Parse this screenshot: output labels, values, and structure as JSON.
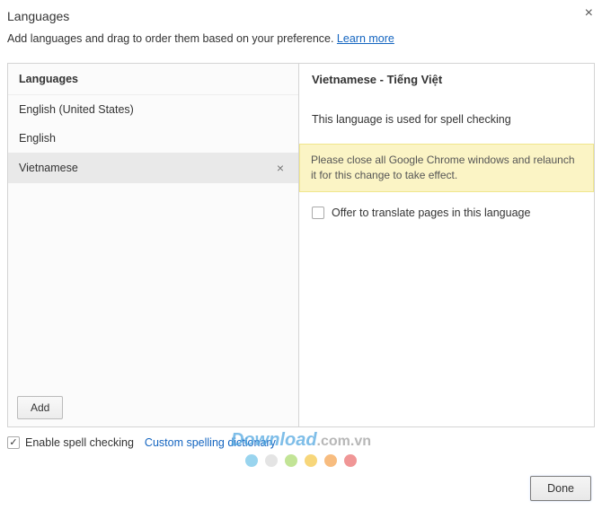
{
  "header": {
    "title": "Languages",
    "subtitle_text": "Add languages and drag to order them based on your preference. ",
    "learn_more": "Learn more"
  },
  "left": {
    "heading": "Languages",
    "items": [
      {
        "label": "English (United States)",
        "selected": false
      },
      {
        "label": "English",
        "selected": false
      },
      {
        "label": "Vietnamese",
        "selected": true
      }
    ],
    "add_label": "Add"
  },
  "right": {
    "heading": "Vietnamese - Tiếng Việt",
    "spell_text": "This language is used for spell checking",
    "warning": "Please close all Google Chrome windows and relaunch it for this change to take effect.",
    "offer_translate_label": "Offer to translate pages in this language",
    "offer_translate_checked": false
  },
  "footer": {
    "enable_spell_label": "Enable spell checking",
    "enable_spell_checked": true,
    "custom_dict": "Custom spelling dictionary",
    "done_label": "Done"
  },
  "watermark": {
    "brand_a": "Download",
    "brand_b": ".com.vn",
    "dot_colors": [
      "#6fc3e8",
      "#d9d9d9",
      "#a9d96a",
      "#f5c542",
      "#f5a04a",
      "#e96a6a"
    ]
  }
}
